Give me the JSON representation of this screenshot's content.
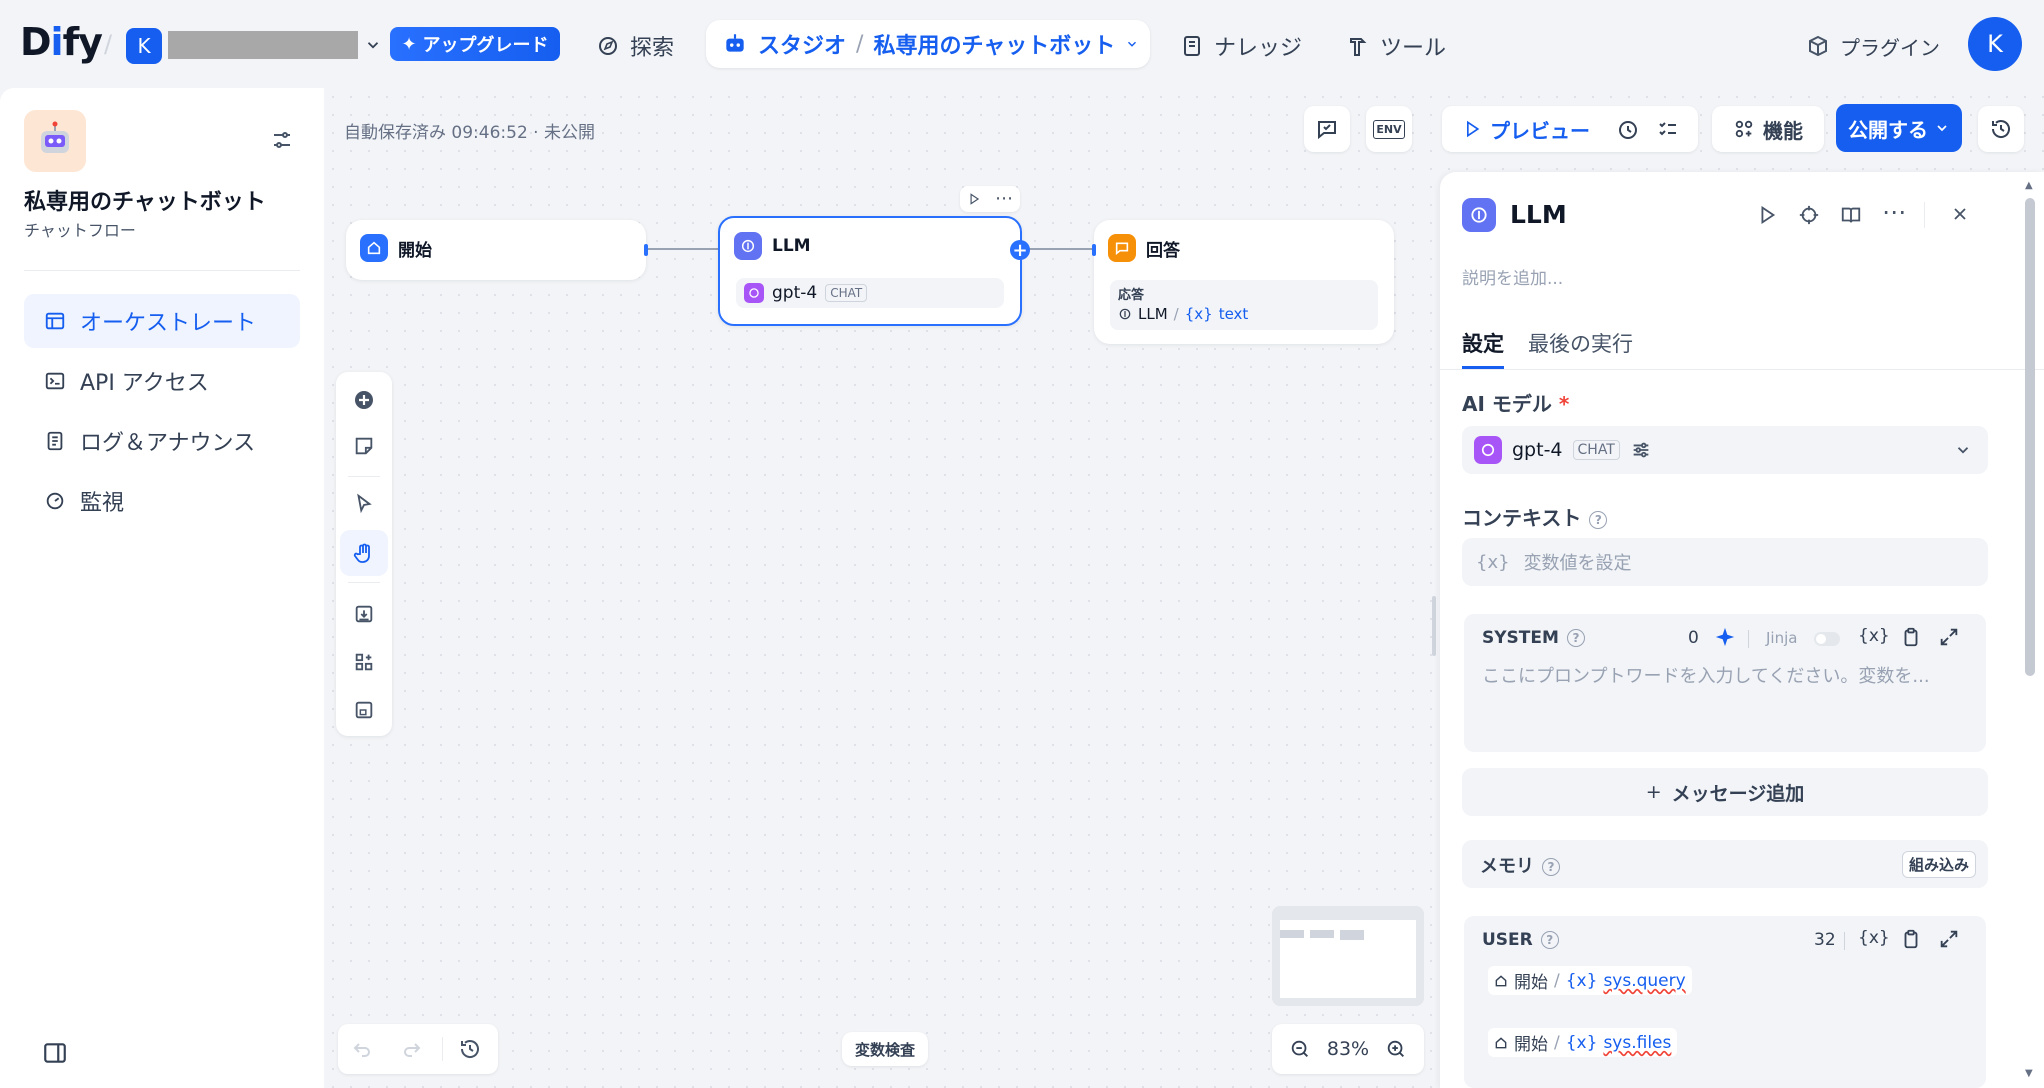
{
  "topbar": {
    "logo_prefix": "D",
    "logo_i": "i",
    "logo_suffix": "fy",
    "workspace_initial": "K",
    "upgrade_label": "アップグレード",
    "nav_explore": "探索",
    "nav_studio": "スタジオ",
    "current_app": "私専用のチャットボット",
    "nav_knowledge": "ナレッジ",
    "nav_tools": "ツール",
    "plugins": "プラグイン",
    "user_initial": "K"
  },
  "sidebar": {
    "app_title": "私専用のチャットボット",
    "app_type": "チャットフロー",
    "items": [
      {
        "label": "オーケストレート",
        "active": true
      },
      {
        "label": "API アクセス",
        "active": false
      },
      {
        "label": "ログ＆アナウンス",
        "active": false
      },
      {
        "label": "監視",
        "active": false
      }
    ]
  },
  "canvas": {
    "autosave": "自動保存済み 09:46:52 · 未公開",
    "preview_label": "プレビュー",
    "features_label": "機能",
    "publish_label": "公開する",
    "env_label": "ENV",
    "nodes": {
      "start": {
        "title": "開始"
      },
      "llm": {
        "title": "LLM",
        "model": "gpt-4",
        "mode": "CHAT"
      },
      "answer": {
        "title": "回答",
        "field_label": "応答",
        "source": "LLM",
        "var": "text"
      }
    },
    "variable_inspect": "変数検査",
    "zoom": "83%"
  },
  "panel": {
    "title": "LLM",
    "description_placeholder": "説明を追加...",
    "tabs": [
      {
        "label": "設定",
        "active": true
      },
      {
        "label": "最後の実行",
        "active": false
      }
    ],
    "ai_model_label": "AI モデル",
    "required_mark": "*",
    "model_name": "gpt-4",
    "model_mode": "CHAT",
    "context_label": "コンテキスト",
    "context_placeholder": "変数値を設定",
    "var_icon": "{x}",
    "system": {
      "label": "SYSTEM",
      "count": "0",
      "jinja_label": "Jinja",
      "placeholder": "ここにプロンプトワードを入力してください。変数を..."
    },
    "add_message": "メッセージ追加",
    "memory_label": "メモリ",
    "memory_badge": "組み込み",
    "user": {
      "label": "USER",
      "count": "32",
      "vars": [
        {
          "source": "開始",
          "name": "sys.query"
        },
        {
          "source": "開始",
          "name": "sys.files"
        }
      ]
    }
  },
  "colors": {
    "accent": "#155eef",
    "llm_icon": "#6172f3",
    "answer_icon": "#f79009",
    "gpt_icon": "#a855f7"
  }
}
